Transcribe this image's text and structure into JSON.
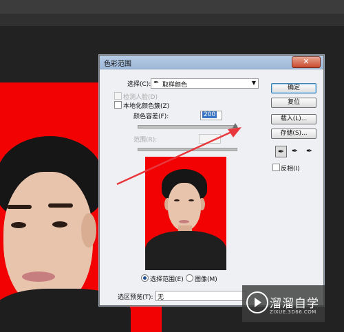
{
  "dialog": {
    "title": "色彩范围",
    "select_label": "选择(C):",
    "select_icon": "eyedropper-icon",
    "select_value": "取样颜色",
    "detect_faces_label": "检测人脸(D)",
    "localized_clusters_label": "本地化颜色簇(Z)",
    "fuzziness_label": "颜色容差(F):",
    "fuzziness_value": "200",
    "fuzziness": 200,
    "range_label": "范围(R):",
    "selection_radio": "选择范围(E)",
    "image_radio": "图像(M)",
    "preview_label": "选区预览(T):",
    "preview_value": "无",
    "buttons": {
      "ok": "确定",
      "reset": "复位",
      "load": "载入(L)...",
      "save": "存储(S)..."
    },
    "invert_label": "反相(I)",
    "close_icon": "close-icon"
  },
  "watermark": {
    "name": "溜溜自学",
    "url": "ZIXUE.3D66.COM"
  },
  "colors": {
    "photo_background": "#f20202",
    "annotation_arrow": "#e8383d"
  }
}
